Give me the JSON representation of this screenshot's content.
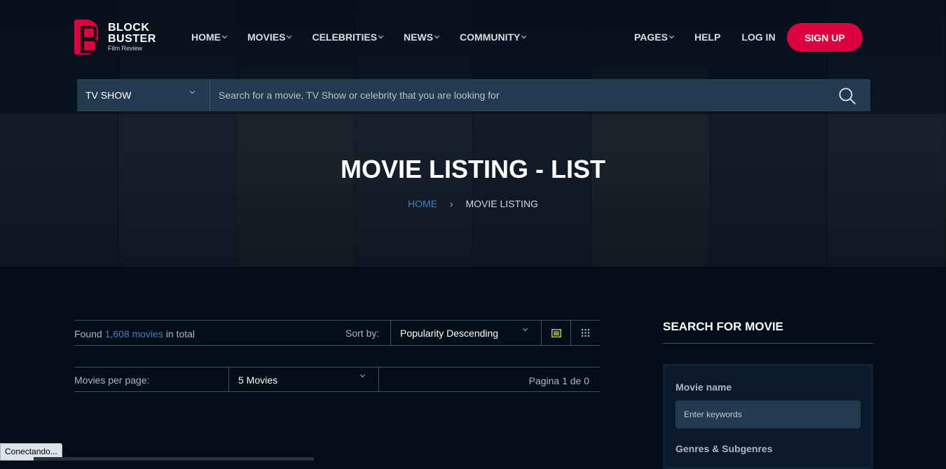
{
  "logo": {
    "line1": "BLOCK",
    "line2": "BUSTER",
    "sub": "Film Review"
  },
  "nav": {
    "left": [
      {
        "label": "HOME"
      },
      {
        "label": "MOVIES"
      },
      {
        "label": "CELEBRITIES"
      },
      {
        "label": "NEWS"
      },
      {
        "label": "COMMUNITY"
      }
    ],
    "pages": "PAGES",
    "help": "HELP",
    "login": "LOG IN",
    "signup": "SIGN UP"
  },
  "search": {
    "type": "TV SHOW",
    "placeholder": "Search for a movie, TV Show or celebrity that you are looking for"
  },
  "hero": {
    "title": "MOVIE LISTING - LIST",
    "breadcrumb_home": "HOME",
    "breadcrumb_current": "MOVIE LISTING"
  },
  "listing": {
    "found_prefix": "Found",
    "found_count": "1,608 movies",
    "found_suffix": "in total",
    "sort_label": "Sort by:",
    "sort_value": "Popularity Descending",
    "per_page_label": "Movies per page:",
    "per_page_value": "5 Movies",
    "pagination": "Pagina 1 de 0"
  },
  "sidebar": {
    "title": "SEARCH FOR MOVIE",
    "movie_name_label": "Movie name",
    "keywords_placeholder": "Enter keywords",
    "genres_label": "Genres & Subgenres"
  },
  "status": {
    "text": "Conectando..."
  },
  "colors": {
    "accent": "#dd003f",
    "link": "#4280bf",
    "active_icon": "#dcf836",
    "background": "#020d18",
    "input_bg": "#233a50"
  }
}
